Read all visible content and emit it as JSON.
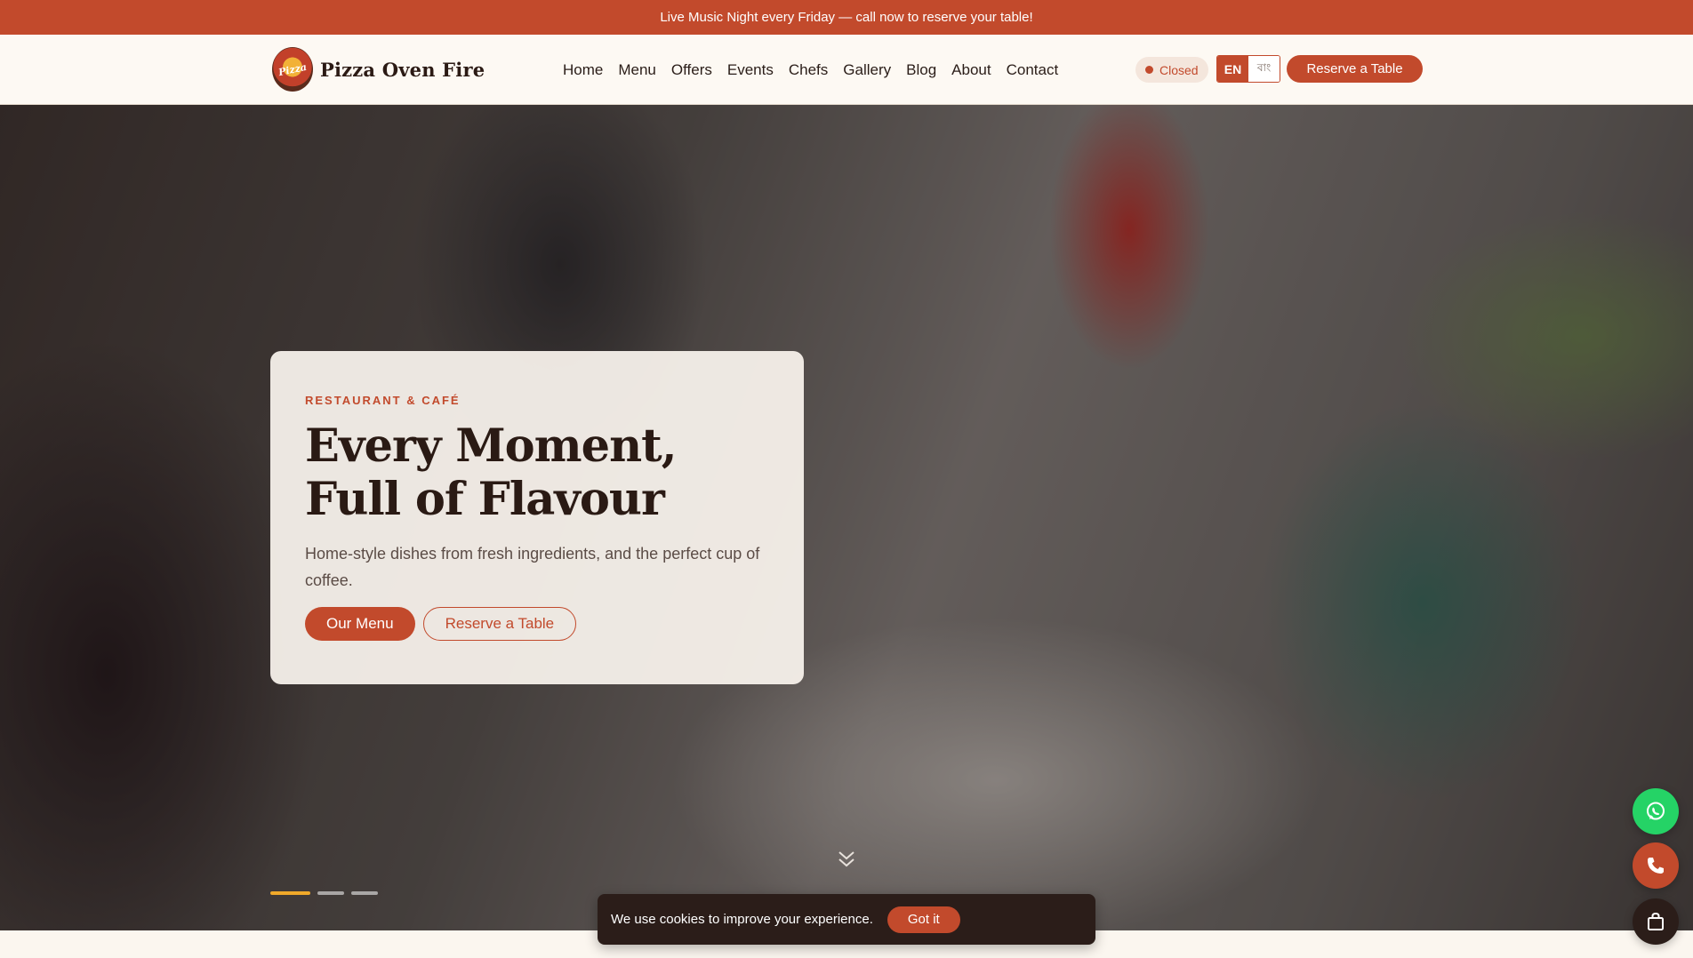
{
  "announcement": {
    "text": "Live Music Night every Friday — call now to reserve your table!"
  },
  "brand": {
    "logo_text": "Pizza",
    "name": "Pizza Oven Fire"
  },
  "nav": {
    "links": [
      "Home",
      "Menu",
      "Offers",
      "Events",
      "Chefs",
      "Gallery",
      "Blog",
      "About",
      "Contact"
    ],
    "status": "Closed",
    "lang_en": "EN",
    "lang_bn": "বাং",
    "reserve_label": "Reserve a Table"
  },
  "hero": {
    "eyebrow": "RESTAURANT & CAFÉ",
    "title": "Every Moment, Full of Flavour",
    "subtitle": "Home-style dishes from fresh ingredients, and the perfect cup of coffee.",
    "primary_label": "Our Menu",
    "secondary_label": "Reserve a Table",
    "slides": 3,
    "active_slide": 1
  },
  "cookie": {
    "text": "We use cookies to improve your experience.",
    "button_label": "Got it"
  },
  "fabs": [
    "whatsapp-icon",
    "phone-icon",
    "shopping-bag-icon"
  ],
  "colors": {
    "accent": "#c24a2c",
    "dark": "#2b1d19",
    "cream": "#fbf6ef",
    "whatsapp": "#25d366",
    "gold": "#f0a92a"
  }
}
